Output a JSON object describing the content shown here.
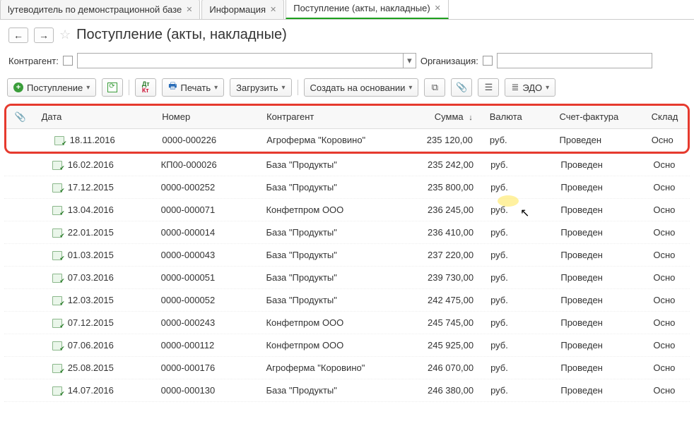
{
  "tabs": [
    {
      "label": "lутеводитель по демонстрационной базе",
      "active": false
    },
    {
      "label": "Информация",
      "active": false
    },
    {
      "label": "Поступление (акты, накладные)",
      "active": true
    }
  ],
  "title": "Поступление (акты, накладные)",
  "filters": {
    "counterparty_label": "Контрагент:",
    "organization_label": "Организация:"
  },
  "toolbar": {
    "receipt": "Поступление",
    "print": "Печать",
    "load": "Загрузить",
    "create_based": "Создать на основании",
    "edo": "ЭДО"
  },
  "columns": {
    "date": "Дата",
    "number": "Номер",
    "agent": "Контрагент",
    "sum": "Сумма",
    "currency": "Валюта",
    "invoice": "Счет-фактура",
    "warehouse": "Склад"
  },
  "rows": [
    {
      "date": "18.11.2016",
      "num": "0000-000226",
      "agent": "Агроферма \"Коровино\"",
      "sum": "235 120,00",
      "cur": "руб.",
      "sf": "Проведен",
      "wh": "Осно"
    },
    {
      "date": "16.02.2016",
      "num": "КП00-000026",
      "agent": "База \"Продукты\"",
      "sum": "235 242,00",
      "cur": "руб.",
      "sf": "Проведен",
      "wh": "Осно"
    },
    {
      "date": "17.12.2015",
      "num": "0000-000252",
      "agent": "База \"Продукты\"",
      "sum": "235 800,00",
      "cur": "руб.",
      "sf": "Проведен",
      "wh": "Осно"
    },
    {
      "date": "13.04.2016",
      "num": "0000-000071",
      "agent": "Конфетпром ООО",
      "sum": "236 245,00",
      "cur": "руб.",
      "sf": "Проведен",
      "wh": "Осно"
    },
    {
      "date": "22.01.2015",
      "num": "0000-000014",
      "agent": "База \"Продукты\"",
      "sum": "236 410,00",
      "cur": "руб.",
      "sf": "Проведен",
      "wh": "Осно"
    },
    {
      "date": "01.03.2015",
      "num": "0000-000043",
      "agent": "База \"Продукты\"",
      "sum": "237 220,00",
      "cur": "руб.",
      "sf": "Проведен",
      "wh": "Осно"
    },
    {
      "date": "07.03.2016",
      "num": "0000-000051",
      "agent": "База \"Продукты\"",
      "sum": "239 730,00",
      "cur": "руб.",
      "sf": "Проведен",
      "wh": "Осно"
    },
    {
      "date": "12.03.2015",
      "num": "0000-000052",
      "agent": "База \"Продукты\"",
      "sum": "242 475,00",
      "cur": "руб.",
      "sf": "Проведен",
      "wh": "Осно"
    },
    {
      "date": "07.12.2015",
      "num": "0000-000243",
      "agent": "Конфетпром ООО",
      "sum": "245 745,00",
      "cur": "руб.",
      "sf": "Проведен",
      "wh": "Осно"
    },
    {
      "date": "07.06.2016",
      "num": "0000-000112",
      "agent": "Конфетпром ООО",
      "sum": "245 925,00",
      "cur": "руб.",
      "sf": "Проведен",
      "wh": "Осно"
    },
    {
      "date": "25.08.2015",
      "num": "0000-000176",
      "agent": "Агроферма \"Коровино\"",
      "sum": "246 070,00",
      "cur": "руб.",
      "sf": "Проведен",
      "wh": "Осно"
    },
    {
      "date": "14.07.2016",
      "num": "0000-000130",
      "agent": "База \"Продукты\"",
      "sum": "246 380,00",
      "cur": "руб.",
      "sf": "Проведен",
      "wh": "Осно"
    }
  ]
}
